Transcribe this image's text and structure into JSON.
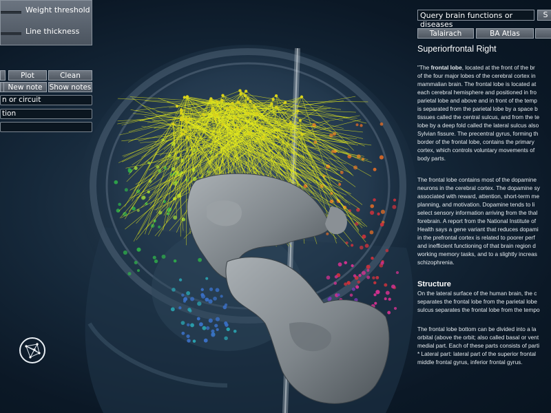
{
  "controls": {
    "weight_threshold_label": "Weight threshold",
    "line_thickness_label": "Line thickness",
    "plot_label": "Plot",
    "clean_label": "Clean",
    "new_note_label": "New note",
    "show_notes_label": "Show notes",
    "field_1": "n or circuit",
    "field_2": "tion",
    "field_3": ""
  },
  "search": {
    "value": "Query brain functions or diseases",
    "button_label": "S"
  },
  "atlas_tabs": [
    "Talairach",
    "BA Atlas",
    ""
  ],
  "region": {
    "title": "Superiorfrontal Right"
  },
  "description": {
    "p1_prefix": "\"The ",
    "p1_bold": "frontal lobe",
    "p1_lines": [
      ", located at the front of the br",
      "of the four major lobes of the cerebral cortex in",
      "mammalian brain. The frontal lobe is located at",
      "each cerebral hemisphere and positioned in fro",
      "parietal lobe and above and in front of the temp",
      "is separated from the parietal lobe by a space b",
      "tissues called the central sulcus, and from the te",
      "lobe by a deep fold called the lateral sulcus also",
      "Sylvian fissure.  The precentral gyrus, forming th",
      "border of the frontal lobe, contains the primary",
      "cortex, which controls voluntary movements of",
      "body parts."
    ],
    "p2_lines": [
      "The frontal lobe contains most of the dopamine",
      "neurons in the cerebral cortex. The dopamine sy",
      "associated with reward, attention, short-term me",
      "planning, and motivation. Dopamine tends to li",
      "select sensory information arriving from the thal",
      "forebrain. A report from the National Institute of",
      "Health says a gene variant that reduces dopami",
      "in the prefrontal cortex is related to poorer perf",
      "and inefficient functioning of that brain region d",
      "working memory tasks, and to a slightly increas",
      "schizophrenia."
    ],
    "structure_heading": "Structure",
    "p3_lines": [
      "On the lateral surface of the human brain, the c",
      "separates the frontal lobe from the parietal lobe",
      "sulcus separates the frontal lobe from the tempo"
    ],
    "p4_lines": [
      "The frontal lobe bottom can be divided into a la",
      "orbital (above the orbit; also called basal or vent",
      "medial part. Each of these parts consists of parti",
      "* Lateral part: lateral part of the superior frontal",
      "middle frontal gyrus,  inferior frontal gyrus."
    ]
  },
  "colors": {
    "edges": "#e4ea1c",
    "edge_nodes": "#d9d21a",
    "brain_surface": "#8f9599",
    "background": "#0e1f2e"
  },
  "icons": [
    "network-logo-icon"
  ]
}
